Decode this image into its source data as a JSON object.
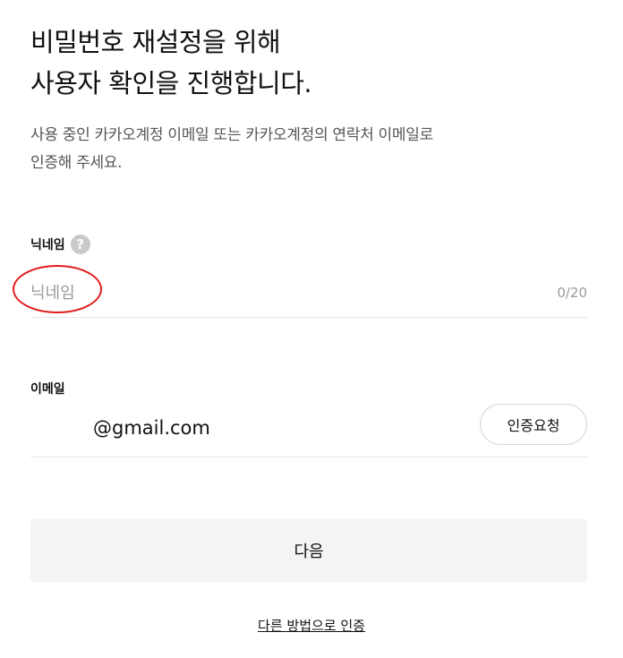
{
  "title": {
    "line1": "비밀번호 재설정을 위해",
    "line2": "사용자 확인을 진행합니다."
  },
  "description": {
    "line1": "사용 중인 카카오계정 이메일 또는 카카오계정의 연락처 이메일로",
    "line2": "인증해 주세요."
  },
  "nickname": {
    "label": "닉네임",
    "help_icon": "question-mark-icon",
    "placeholder": "닉네임",
    "value": "",
    "counter": "0/20"
  },
  "email": {
    "label": "이메일",
    "value": "@gmail.com",
    "verify_button": "인증요청"
  },
  "next_button": "다음",
  "alt_link": "다른 방법으로 인증",
  "colors": {
    "annotation": "#e21d1d",
    "button_bg": "#f4f4f4",
    "muted_text": "#9a9a9a"
  }
}
